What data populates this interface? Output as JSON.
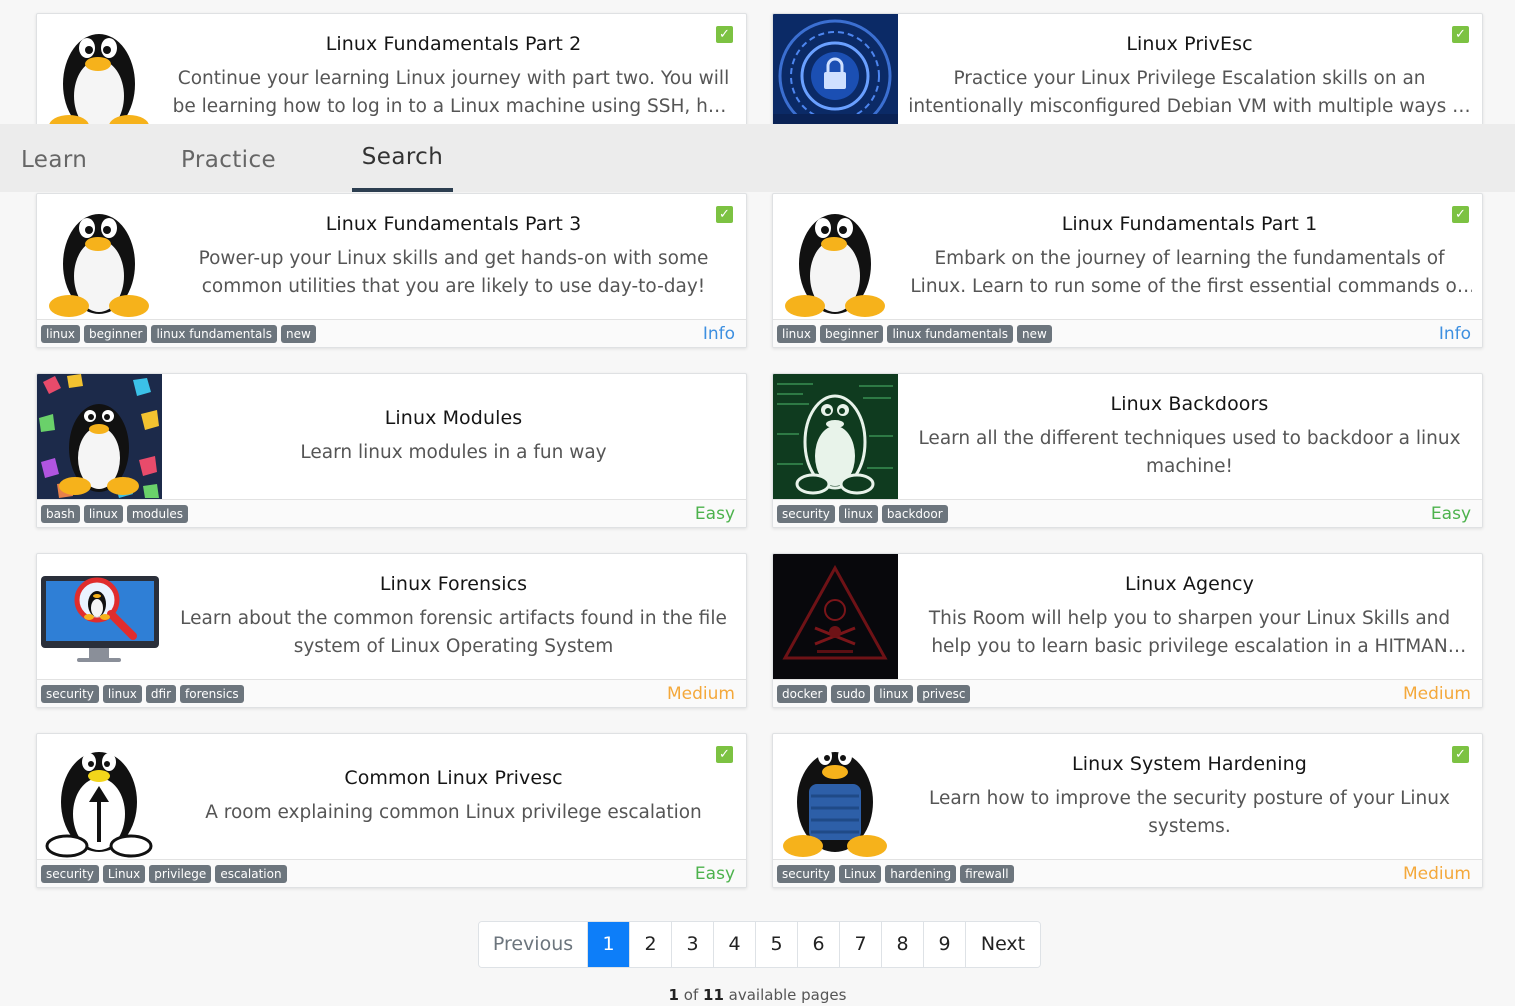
{
  "tabs": [
    "Learn",
    "Practice",
    "Search"
  ],
  "colors": {
    "info": "#3d8fe0",
    "easy": "#4cb24c",
    "medium": "#f4a83a",
    "accent": "#0d7ef9",
    "check": "#7cc242"
  },
  "cards": [
    {
      "title": "Linux Fundamentals Part 2",
      "desc": "Continue your learning Linux journey with part two. You will be learning how to log in to a Linux machine using SSH, how to advance your commands and file system interaction.",
      "tags": [],
      "difficulty": "",
      "completed": true,
      "icon": "tux-penguin-icon"
    },
    {
      "title": "Linux PrivEsc",
      "desc": "Practice your Linux Privilege Escalation skills on an intentionally misconfigured Debian VM with multiple ways to get root!",
      "tags": [],
      "difficulty": "",
      "completed": true,
      "icon": "cyber-lock-icon"
    },
    {
      "title": "Linux Fundamentals Part 3",
      "desc": "Power-up your Linux skills and get hands-on with some common utilities that you are likely to use day-to-day!",
      "tags": [
        "linux",
        "beginner",
        "linux fundamentals",
        "new"
      ],
      "difficulty": "Info",
      "completed": true,
      "icon": "tux-penguin-icon"
    },
    {
      "title": "Linux Fundamentals Part 1",
      "desc": "Embark on the journey of learning the fundamentals of Linux. Learn to run some of the first essential commands on an interactive terminal.",
      "tags": [
        "linux",
        "beginner",
        "linux fundamentals",
        "new"
      ],
      "difficulty": "Info",
      "completed": true,
      "icon": "tux-penguin-icon"
    },
    {
      "title": "Linux Modules",
      "desc": "Learn linux modules in a fun way",
      "tags": [
        "bash",
        "linux",
        "modules"
      ],
      "difficulty": "Easy",
      "completed": false,
      "icon": "tux-gems-icon"
    },
    {
      "title": "Linux Backdoors",
      "desc": "Learn all the different techniques used to backdoor a linux machine!",
      "tags": [
        "security",
        "linux",
        "backdoor"
      ],
      "difficulty": "Easy",
      "completed": false,
      "icon": "tux-terminal-icon"
    },
    {
      "title": "Linux Forensics",
      "desc": "Learn about the common forensic artifacts found in the file system of Linux Operating System",
      "tags": [
        "security",
        "linux",
        "dfir",
        "forensics"
      ],
      "difficulty": "Medium",
      "completed": false,
      "icon": "monitor-magnifier-icon"
    },
    {
      "title": "Linux Agency",
      "desc": "This Room will help you to sharpen your Linux Skills and help you to learn basic privilege escalation in a HITMAN theme. So, pack your briefcase and grab your SilverBallers as its gonna be a tough ride.",
      "tags": [
        "docker",
        "sudo",
        "linux",
        "privesc"
      ],
      "difficulty": "Medium",
      "completed": false,
      "icon": "agency-emblem-icon"
    },
    {
      "title": "Common Linux Privesc",
      "desc": "A room explaining common Linux privilege escalation",
      "tags": [
        "security",
        "Linux",
        "privilege",
        "escalation"
      ],
      "difficulty": "Easy",
      "completed": true,
      "icon": "tux-arrow-icon"
    },
    {
      "title": "Linux System Hardening",
      "desc": "Learn how to improve the security posture of your Linux systems.",
      "tags": [
        "security",
        "Linux",
        "hardening",
        "firewall"
      ],
      "difficulty": "Medium",
      "completed": true,
      "icon": "tux-armor-icon"
    }
  ],
  "pagination": {
    "prev": "Previous",
    "pages": [
      "1",
      "2",
      "3",
      "4",
      "5",
      "6",
      "7",
      "8",
      "9"
    ],
    "current": "1",
    "next": "Next",
    "info_current": "1",
    "info_of": "of",
    "info_total": "11",
    "info_suffix": "available pages"
  }
}
